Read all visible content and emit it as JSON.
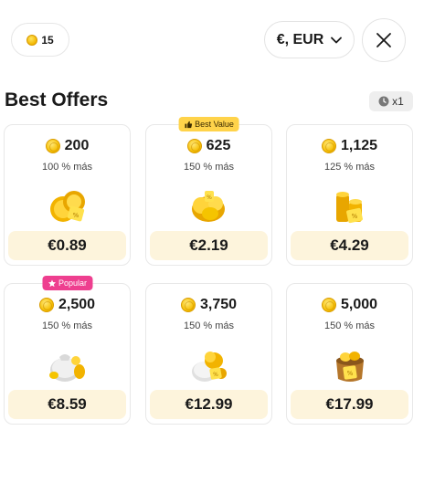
{
  "header": {
    "balance": "15",
    "currency_label": "€, EUR",
    "icons": {
      "balance": "coin-icon",
      "currency": "chevron-down-icon",
      "close": "close-icon"
    }
  },
  "section": {
    "title": "Best Offers",
    "timer_label": "x1",
    "timer_icon": "clock-icon"
  },
  "offers": [
    {
      "amount": "200",
      "bonus": "100 % más",
      "price": "€0.89",
      "badge": ""
    },
    {
      "amount": "625",
      "bonus": "150 % más",
      "price": "€2.19",
      "badge": "Best Value"
    },
    {
      "amount": "1,125",
      "bonus": "125 % más",
      "price": "€4.29",
      "badge": ""
    },
    {
      "amount": "2,500",
      "bonus": "150 % más",
      "price": "€8.59",
      "badge": "Popular"
    },
    {
      "amount": "3,750",
      "bonus": "150 % más",
      "price": "€12.99",
      "badge": ""
    },
    {
      "amount": "5,000",
      "bonus": "150 % más",
      "price": "€17.99",
      "badge": ""
    }
  ],
  "colors": {
    "price_bg": "#fdf4dc",
    "best_value_badge": "#ffd34a",
    "popular_badge": "#ee3f8f",
    "coin": "#f5bd00"
  }
}
